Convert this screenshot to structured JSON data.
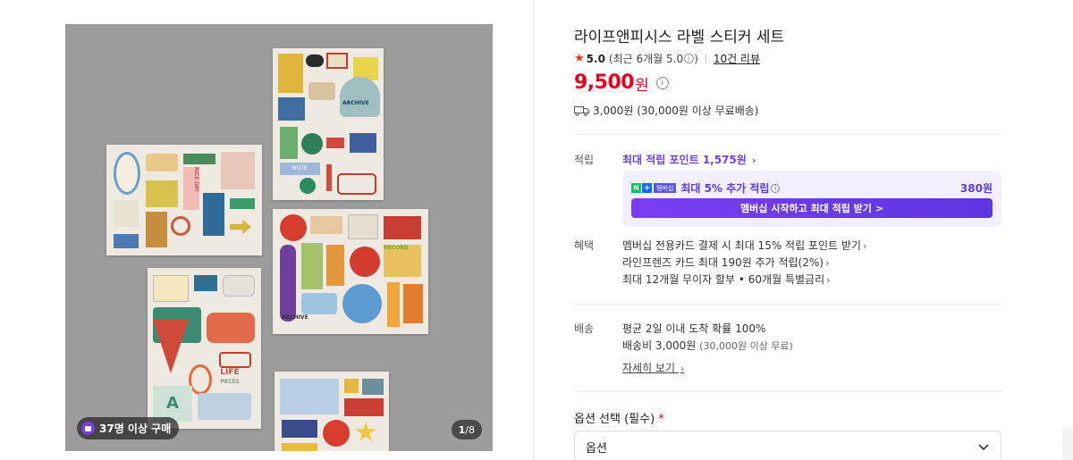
{
  "gallery": {
    "buyers_badge": "37명 이상 구매",
    "counter_current": "1",
    "counter_total": "/8",
    "sticker_text": {
      "niceday": "NICE DAY",
      "archive": "ARCHIVE",
      "note": "NOTE",
      "life": "LIFE",
      "pieces": "PIECES",
      "record": "RECORD",
      "archive2": "ARCHIVE",
      "letter_a": "A"
    }
  },
  "product": {
    "title": "라이프앤피시스 라벨 스티커 세트",
    "rating": "5.0",
    "recent_rating": "(최근 6개월 5.0",
    "recent_rating_close": ")",
    "review_link": "10건 리뷰",
    "price": "9,500",
    "price_unit": "원",
    "shipping_summary": "3,000원 (30,000원 이상 무료배송)"
  },
  "points": {
    "label": "적립",
    "max_link": "최대 적립 포인트 1,575원",
    "member_tag": "멤버십",
    "np_text": "최대 5% 추가 적립",
    "np_amount": "380원",
    "member_button": "멤버십 시작하고 최대 적립 받기 >"
  },
  "benefits": {
    "label": "혜택",
    "items": [
      "멤버십 전용카드 결제 시 최대 15% 적립 포인트 받기",
      "라인프렌즈 카드 최대 190원 추가 적립(2%)",
      "최대 12개월 무이자 할부 • 60개월 특별금리"
    ]
  },
  "delivery": {
    "label": "배송",
    "line1": "평균 2일 이내 도착 확률 100%",
    "line2_main": "배송비 3,000원",
    "line2_sub": "(30,000원 이상 무료)",
    "detail_link": "자세히 보기"
  },
  "option": {
    "title": "옵션 선택 (필수)",
    "required_mark": "*",
    "placeholder": "옵션"
  },
  "colors": {
    "price_red": "#e6001e",
    "accent_purple": "#6b3ff2",
    "naverpay_green": "#03c75a"
  }
}
